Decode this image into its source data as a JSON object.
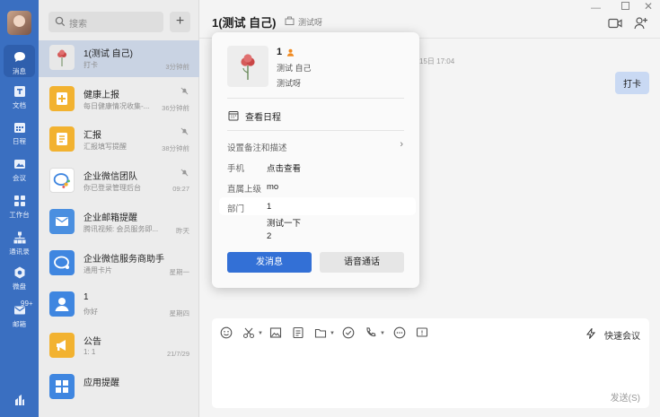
{
  "rail": {
    "items": [
      {
        "label": "消息",
        "icon": "chat-bubble-icon"
      },
      {
        "label": "文档",
        "icon": "document-icon"
      },
      {
        "label": "日程",
        "icon": "calendar-icon"
      },
      {
        "label": "会议",
        "icon": "meeting-icon"
      },
      {
        "label": "工作台",
        "icon": "workbench-icon"
      },
      {
        "label": "通讯录",
        "icon": "contacts-icon"
      },
      {
        "label": "微盘",
        "icon": "drive-icon"
      },
      {
        "label": "邮箱",
        "icon": "mail-icon",
        "badge": "99+"
      }
    ],
    "accent": "#3a6fc1"
  },
  "search": {
    "placeholder": "搜索"
  },
  "conversations": [
    {
      "name": "1(测试 自己)",
      "preview": "打卡",
      "time": "3分钟前",
      "muted": false,
      "avatar_color": "#e8e8e8"
    },
    {
      "name": "健康上报",
      "preview": "每日健康情况收集-...",
      "time": "36分钟前",
      "muted": true,
      "avatar_color": "#f2b230"
    },
    {
      "name": "汇报",
      "preview": "汇报填写提醒",
      "time": "38分钟前",
      "muted": true,
      "avatar_color": "#f2b230"
    },
    {
      "name": "企业微信团队",
      "preview": "你已登录管理后台",
      "time": "09:27",
      "muted": true,
      "avatar_color": "#ffffff"
    },
    {
      "name": "企业邮箱提醒",
      "preview": "腾讯视频: 会员服务即...",
      "time": "昨天",
      "muted": false,
      "avatar_color": "#4a8fe0"
    },
    {
      "name": "企业微信服务商助手",
      "preview": "通用卡片",
      "time": "星期一",
      "muted": false,
      "avatar_color": "#3f86e0"
    },
    {
      "name": "1",
      "preview": "你好",
      "time": "星期四",
      "muted": false,
      "avatar_color": "#3f86e0"
    },
    {
      "name": "公告",
      "preview": "1: 1",
      "time": "21/7/29",
      "muted": false,
      "avatar_color": "#f2b230"
    },
    {
      "name": "应用提醒",
      "preview": "",
      "time": "",
      "muted": false,
      "avatar_color": "#3f86e0"
    }
  ],
  "chat": {
    "title": "1(测试 自己)",
    "subtitle": "测试呀",
    "timestamp": "15日 17:04",
    "message": "打卡",
    "quick_meeting": "快速会议",
    "send_label": "发送(S)"
  },
  "profile": {
    "name": "1",
    "line1": "测试 自己",
    "line2": "测试呀",
    "view_schedule": "查看日程",
    "remark_label": "设置备注和描述",
    "phone_key": "手机",
    "phone_val": "点击查看",
    "manager_key": "直属上级",
    "manager_val": "mo",
    "dept_key": "部门",
    "dept_values": [
      "1",
      "测试一下",
      "2"
    ],
    "send_msg": "发消息",
    "voice_call": "语音通话",
    "primary_color": "#3370d6"
  }
}
